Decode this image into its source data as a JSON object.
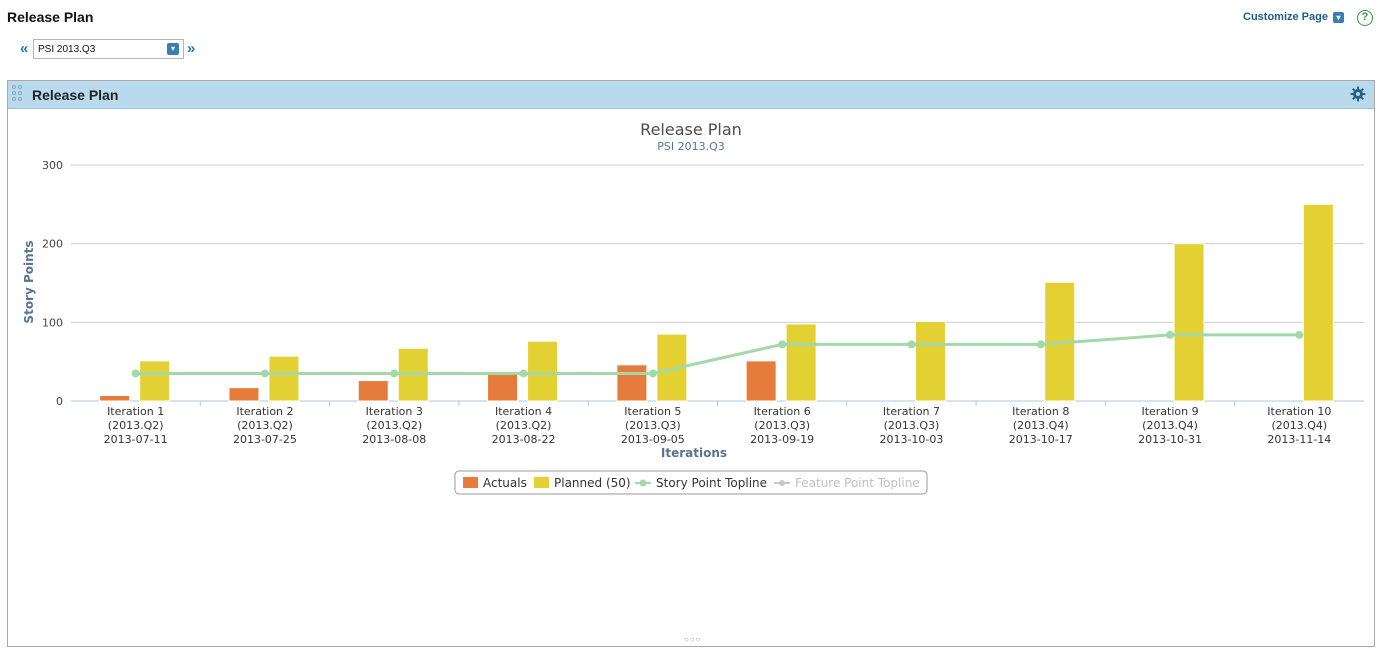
{
  "page": {
    "title": "Release Plan"
  },
  "header": {
    "customize_label": "Customize Page",
    "help_label": "?"
  },
  "release_picker": {
    "prev_label": "«",
    "next_label": "»",
    "value": "PSI 2013.Q3"
  },
  "panel": {
    "title": "Release Plan"
  },
  "colors": {
    "actuals": "#e67c3c",
    "planned": "#e3d033",
    "story_topline": "#a3d9a9",
    "feature_topline": "#c8c8c8",
    "header_bg": "#b9d9ec",
    "axis_title": "#5a7393"
  },
  "chart_data": {
    "type": "bar",
    "title": "Release Plan",
    "subtitle": "PSI 2013.Q3",
    "xlabel": "Iterations",
    "ylabel": "Story Points",
    "ylim": [
      0,
      300
    ],
    "yticks": [
      0,
      100,
      200,
      300
    ],
    "grid": true,
    "legend_position": "bottom-center",
    "categories": [
      [
        "Iteration 1",
        "(2013.Q2)",
        "2013-07-11"
      ],
      [
        "Iteration 2",
        "(2013.Q2)",
        "2013-07-25"
      ],
      [
        "Iteration 3",
        "(2013.Q2)",
        "2013-08-08"
      ],
      [
        "Iteration 4",
        "(2013.Q2)",
        "2013-08-22"
      ],
      [
        "Iteration 5",
        "(2013.Q3)",
        "2013-09-05"
      ],
      [
        "Iteration 6",
        "(2013.Q3)",
        "2013-09-19"
      ],
      [
        "Iteration 7",
        "(2013.Q3)",
        "2013-10-03"
      ],
      [
        "Iteration 8",
        "(2013.Q4)",
        "2013-10-17"
      ],
      [
        "Iteration 9",
        "(2013.Q4)",
        "2013-10-31"
      ],
      [
        "Iteration 10",
        "(2013.Q4)",
        "2013-11-14"
      ]
    ],
    "series": [
      {
        "name": "Actuals",
        "kind": "bar",
        "values": [
          7,
          17,
          26,
          36,
          46,
          51,
          null,
          null,
          null,
          null
        ]
      },
      {
        "name": "Planned (50)",
        "kind": "bar",
        "values": [
          51,
          57,
          67,
          76,
          85,
          98,
          101,
          151,
          200,
          250
        ]
      },
      {
        "name": "Story Point Topline",
        "kind": "line",
        "values": [
          35,
          35,
          35,
          35,
          35,
          72,
          72,
          72,
          84,
          84
        ]
      },
      {
        "name": "Feature Point Topline",
        "kind": "line",
        "hidden": true,
        "values": []
      }
    ]
  }
}
